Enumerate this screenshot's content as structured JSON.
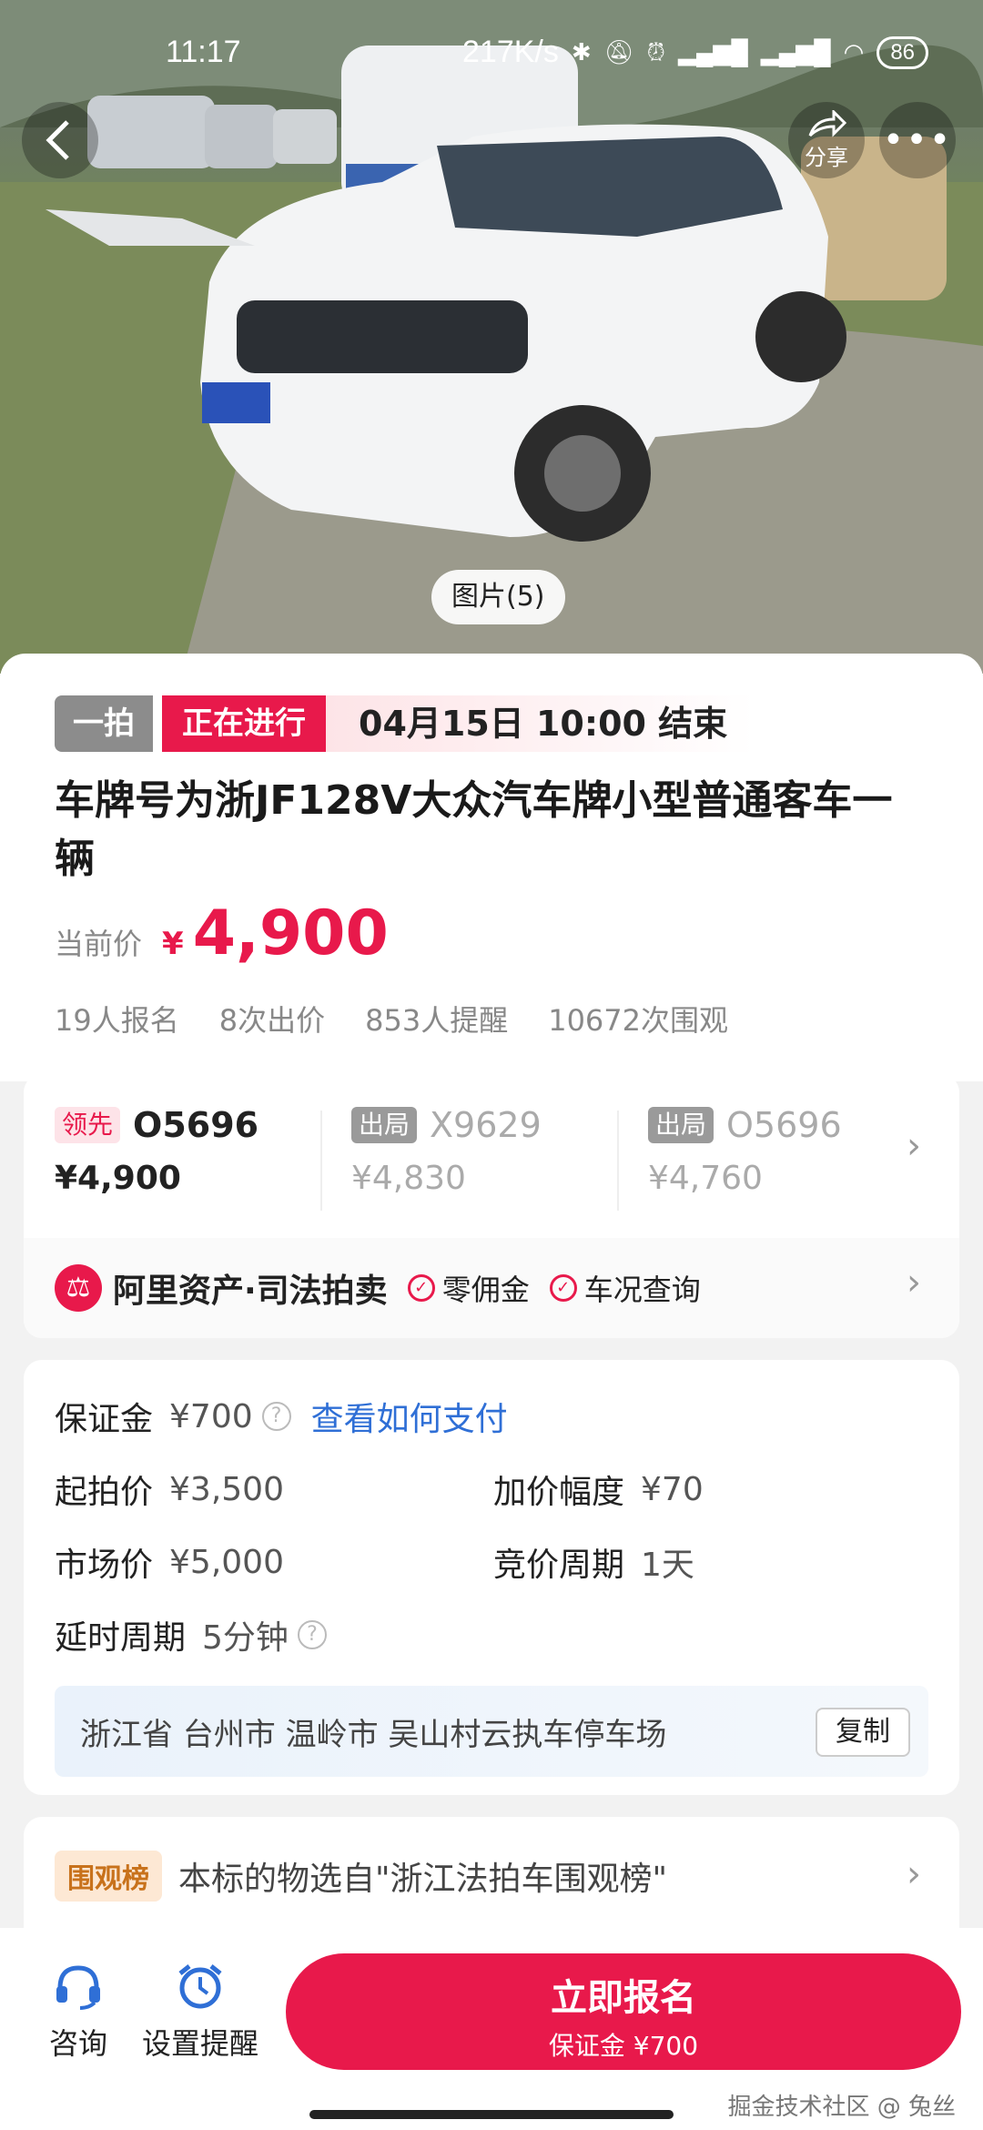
{
  "status_bar": {
    "time": "11:17",
    "net_speed": "217K/s",
    "battery": "86"
  },
  "header": {
    "share_label": "分享",
    "photo_count": "图片(5)"
  },
  "auction": {
    "mode_tag": "一拍",
    "status_tag": "正在进行",
    "end_time": "04月15日 10:00 结束",
    "title": "车牌号为浙JF128V大众汽车牌小型普通客车一辆",
    "price_label": "当前价",
    "currency": "¥",
    "current_price": "4,900",
    "stats": [
      "19人报名",
      "8次出价",
      "853人提醒",
      "10672次围观"
    ]
  },
  "bids": [
    {
      "badge": "领先",
      "bidder": "O5696",
      "amount": "¥4,900",
      "state": "lead"
    },
    {
      "badge": "出局",
      "bidder": "X9629",
      "amount": "¥4,830",
      "state": "out"
    },
    {
      "badge": "出局",
      "bidder": "O5696",
      "amount": "¥4,760",
      "state": "out"
    }
  ],
  "platform": {
    "name": "阿里资产·司法拍卖",
    "features": [
      "零佣金",
      "车况查询"
    ]
  },
  "info": {
    "deposit_label": "保证金",
    "deposit_value": "¥700",
    "deposit_link": "查看如何支付",
    "start_price_label": "起拍价",
    "start_price_value": "¥3,500",
    "increment_label": "加价幅度",
    "increment_value": "¥70",
    "market_price_label": "市场价",
    "market_price_value": "¥5,000",
    "cycle_label": "竞价周期",
    "cycle_value": "1天",
    "delay_label": "延时周期",
    "delay_value": "5分钟",
    "address": "浙江省 台州市 温岭市 吴山村云执车停车场",
    "copy_label": "复制"
  },
  "ranking": {
    "badge": "围观榜",
    "text": "本标的物选自\"浙江法拍车围观榜\""
  },
  "bottom_bar": {
    "consult_label": "咨询",
    "reminder_label": "设置提醒",
    "cta_label": "立即报名",
    "cta_sub": "保证金 ¥700"
  },
  "watermark": "掘金技术社区 @ 兔丝",
  "colors": {
    "accent": "#e8194b",
    "link": "#2f6fd6"
  }
}
